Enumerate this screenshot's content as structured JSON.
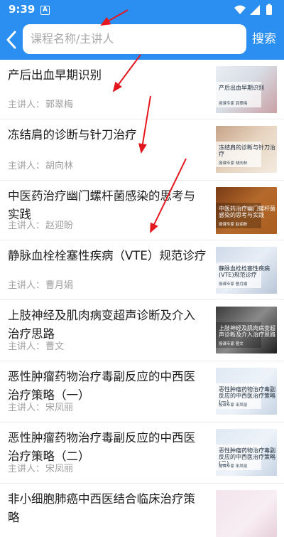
{
  "status_bar": {
    "time": "9:39",
    "app_icon_letter": "A"
  },
  "header": {
    "search": {
      "placeholder": "课程名称/主讲人"
    },
    "search_button": "搜索"
  },
  "speaker_label": "主讲人：",
  "courses": [
    {
      "title": "产后出血早期识别",
      "speaker": "郭翠梅",
      "thumb_title": "产后出血早期识别",
      "thumb_sub": "授课专家  郭翠梅"
    },
    {
      "title": "冻结肩的诊断与针刀治疗",
      "speaker": "胡向林",
      "thumb_title": "冻结肩的诊断与针刀治疗",
      "thumb_sub": "授课专家  胡向林"
    },
    {
      "title": "中医药治疗幽门螺杆菌感染的思考与实践",
      "speaker": "赵迎盼",
      "thumb_title": "中医药治疗幽门螺杆菌感染的思考与实践",
      "thumb_sub": "授课专家  赵迎盼"
    },
    {
      "title": "静脉血栓栓塞性疾病（VTE）规范诊疗",
      "speaker": "曹月娟",
      "thumb_title": "静脉血栓栓塞性疾病(VTE)规范诊疗",
      "thumb_sub": "授课专家  曹月娟"
    },
    {
      "title": "上肢神经及肌肉病变超声诊断及介入治疗思路",
      "speaker": "曹文",
      "thumb_title": "上肢神经及肌肉病变超声诊断及介入治疗思路",
      "thumb_sub": "授课专家  曹文"
    },
    {
      "title": "恶性肿瘤药物治疗毒副反应的中西医治疗策略（一）",
      "speaker": "宋凤丽",
      "thumb_title": "恶性肿瘤药物治疗毒副反应的中西医治疗策略(一)",
      "thumb_sub": "授课专家  宋凤丽"
    },
    {
      "title": "恶性肿瘤药物治疗毒副反应的中西医治疗策略（二）",
      "speaker": "宋凤丽",
      "thumb_title": "恶性肿瘤药物治疗毒副反应的中西医治疗策略(二)",
      "thumb_sub": "授课专家  宋凤丽"
    },
    {
      "title": "非小细胞肺癌中西医结合临床治疗策略",
      "speaker": "",
      "thumb_title": "",
      "thumb_sub": ""
    }
  ],
  "colors": {
    "primary": "#2a8ff0",
    "annotation_arrow": "#e3171e"
  }
}
